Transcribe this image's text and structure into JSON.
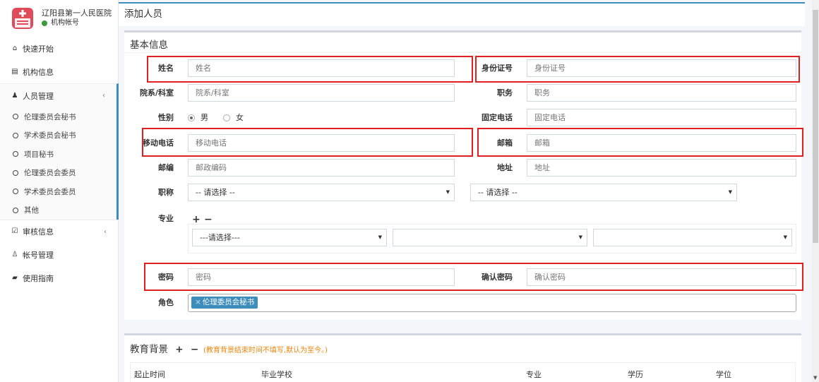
{
  "brand": {
    "title": "辽阳县第一人民医院",
    "subtitle": "机构帐号",
    "status_color": "#3c9a3c"
  },
  "nav": {
    "quick_start": "快速开始",
    "org_info": "机构信息",
    "people": "人员管理",
    "people_sub": [
      "伦理委员会秘书",
      "学术委员会秘书",
      "项目秘书",
      "伦理委员会委员",
      "学术委员会委员",
      "其他"
    ],
    "review": "审核信息",
    "account": "帐号管理",
    "guide": "使用指南",
    "chevron": "‹"
  },
  "page": {
    "title": "添加人员"
  },
  "basic": {
    "title": "基本信息",
    "name_label": "姓名",
    "name_ph": "姓名",
    "idcard_label": "身份证号",
    "idcard_ph": "身份证号",
    "dept_label": "院系/科室",
    "dept_ph": "院系/科室",
    "job_label": "职务",
    "job_ph": "职务",
    "gender_label": "性别",
    "gender_male": "男",
    "gender_female": "女",
    "phone_label": "固定电话",
    "phone_ph": "固定电话",
    "mobile_label": "移动电话",
    "mobile_ph": "移动电话",
    "email_label": "邮箱",
    "email_ph": "邮箱",
    "zip_label": "邮编",
    "zip_ph": "邮政编码",
    "addr_label": "地址",
    "addr_ph": "地址",
    "title_label": "职称",
    "title_sel1": "-- 请选择 --",
    "title_sel2": "-- 请选择 --",
    "spec_label": "专业",
    "plus": "+",
    "minus": "−",
    "spec_sel1": "---请选择---",
    "pwd_label": "密码",
    "pwd_ph": "密码",
    "pwd2_label": "确认密码",
    "pwd2_ph": "确认密码",
    "role_label": "角色",
    "role_tag": "伦理委员会秘书",
    "role_x": "×"
  },
  "edu": {
    "title": "教育背景",
    "plus": "+",
    "minus": "−",
    "note": "(教育背景结束时间不填写,默认为至今。)",
    "cols": [
      "起止时间",
      "毕业学校",
      "专业",
      "学历",
      "学位"
    ]
  },
  "colors": {
    "accent": "#3c8dbc",
    "highlight": "#e02020",
    "note": "#e8850c"
  }
}
